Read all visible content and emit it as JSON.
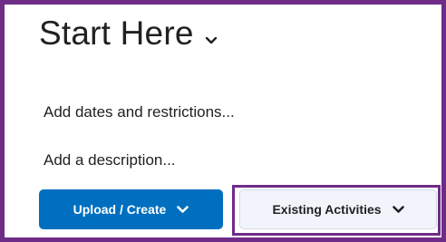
{
  "module": {
    "title": "Start Here"
  },
  "links": {
    "dates": "Add dates and restrictions...",
    "description": "Add a description..."
  },
  "buttons": {
    "upload_create": "Upload / Create",
    "existing_activities": "Existing Activities"
  },
  "colors": {
    "frame": "#6e2c87",
    "primary": "#006fbf",
    "secondary_bg": "#f1f5fb",
    "text": "#202122"
  },
  "icons": {
    "title_toggle": "chevron-down-icon",
    "upload_dropdown": "chevron-down-icon",
    "existing_dropdown": "chevron-down-icon"
  }
}
